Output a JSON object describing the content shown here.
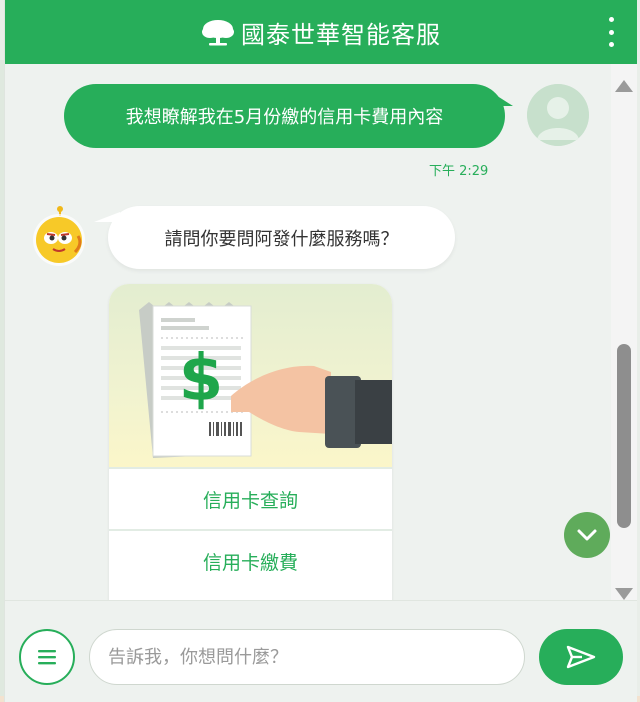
{
  "header": {
    "title": "國泰世華智能客服",
    "logo_icon": "tree-logo-icon",
    "menu_icon": "more-vertical-icon"
  },
  "messages": {
    "user": {
      "text": "我想瞭解我在5月份繳的信用卡費用內容",
      "time": "下午 2:29"
    },
    "bot": {
      "text": "請問你要問阿發什麼服務嗎？"
    }
  },
  "card": {
    "image_icon": "receipt-dollar-icon",
    "options": [
      {
        "label": "信用卡查詢"
      },
      {
        "label": "信用卡繳費"
      }
    ]
  },
  "composer": {
    "placeholder": "告訴我，你想問什麼？",
    "value": "",
    "menu_icon": "hamburger-menu-icon",
    "send_icon": "send-icon"
  },
  "colors": {
    "brand_green": "#27ae5a",
    "scroll_button_green": "#5fab5b",
    "background": "#eef2ef"
  }
}
